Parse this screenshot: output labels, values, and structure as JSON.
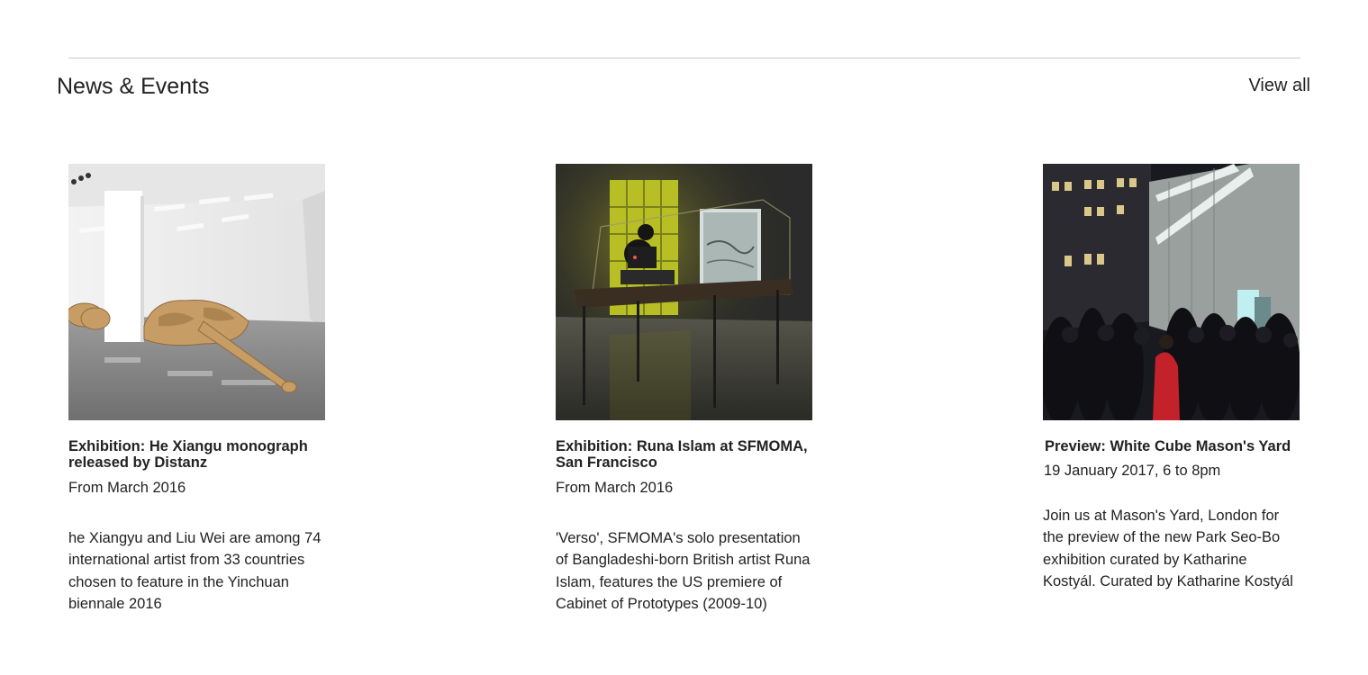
{
  "section": {
    "title": "News & Events",
    "view_all_label": "View all"
  },
  "cards": [
    {
      "image_alt": "Gallery installation of a long reclining figure sculpture in a white room",
      "title": "Exhibition: He Xiangu monograph released by Distanz",
      "date": "From March 2016",
      "body": "he Xiangyu and Liu Wei are among 74 international artist from 33 countries chosen to feature in the Yinchuan biennale 2016"
    },
    {
      "image_alt": "Glass vitrine with a film projector in a dim gallery lit by a yellow window",
      "title": "Exhibition: Runa Islam at SFMOMA, San Francisco",
      "date": "From March 2016",
      "body": "'Verso', SFMOMA's solo presentation of Bangladeshi-born British artist Runa Islam, features the US premiere of Cabinet of Prototypes (2009-10)"
    },
    {
      "image_alt": "Crowd gathered at night in a courtyard outside a modern gallery building",
      "title": "Preview: White Cube Mason's Yard",
      "date": "19 January 2017, 6 to 8pm",
      "body": "Join us at Mason's Yard, London for the preview of the new Park Seo-Bo exhibition curated by Katharine Kostyál. Curated by Katharine Kostyál"
    }
  ]
}
